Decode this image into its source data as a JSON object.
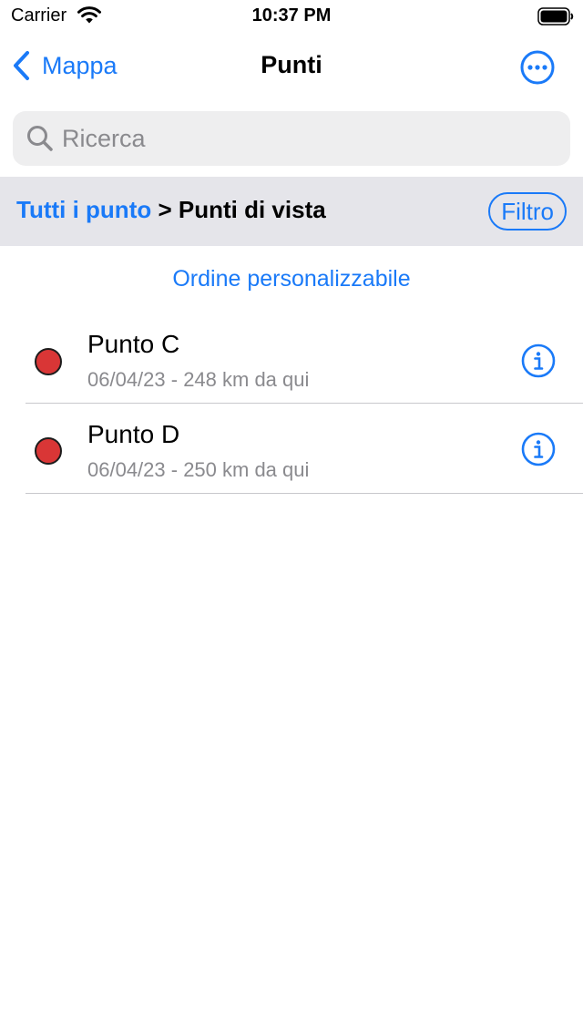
{
  "status_bar": {
    "carrier": "Carrier",
    "time": "10:37 PM"
  },
  "nav": {
    "back_label": "Mappa",
    "title": "Punti"
  },
  "search": {
    "placeholder": "Ricerca",
    "value": ""
  },
  "breadcrumb": {
    "link": "Tutti i punto",
    "separator": ">",
    "current": "Punti di vista"
  },
  "filter_label": "Filtro",
  "order_label": "Ordine personalizzabile",
  "points": [
    {
      "name": "Punto C",
      "detail": "06/04/23 - 248 km da qui",
      "color": "#d93636"
    },
    {
      "name": "Punto D",
      "detail": "06/04/23 - 250 km da qui",
      "color": "#d93636"
    }
  ],
  "colors": {
    "accent": "#1a7af8",
    "marker": "#d93636",
    "band": "#e5e5ea",
    "secondary_text": "#8a8a8e"
  }
}
